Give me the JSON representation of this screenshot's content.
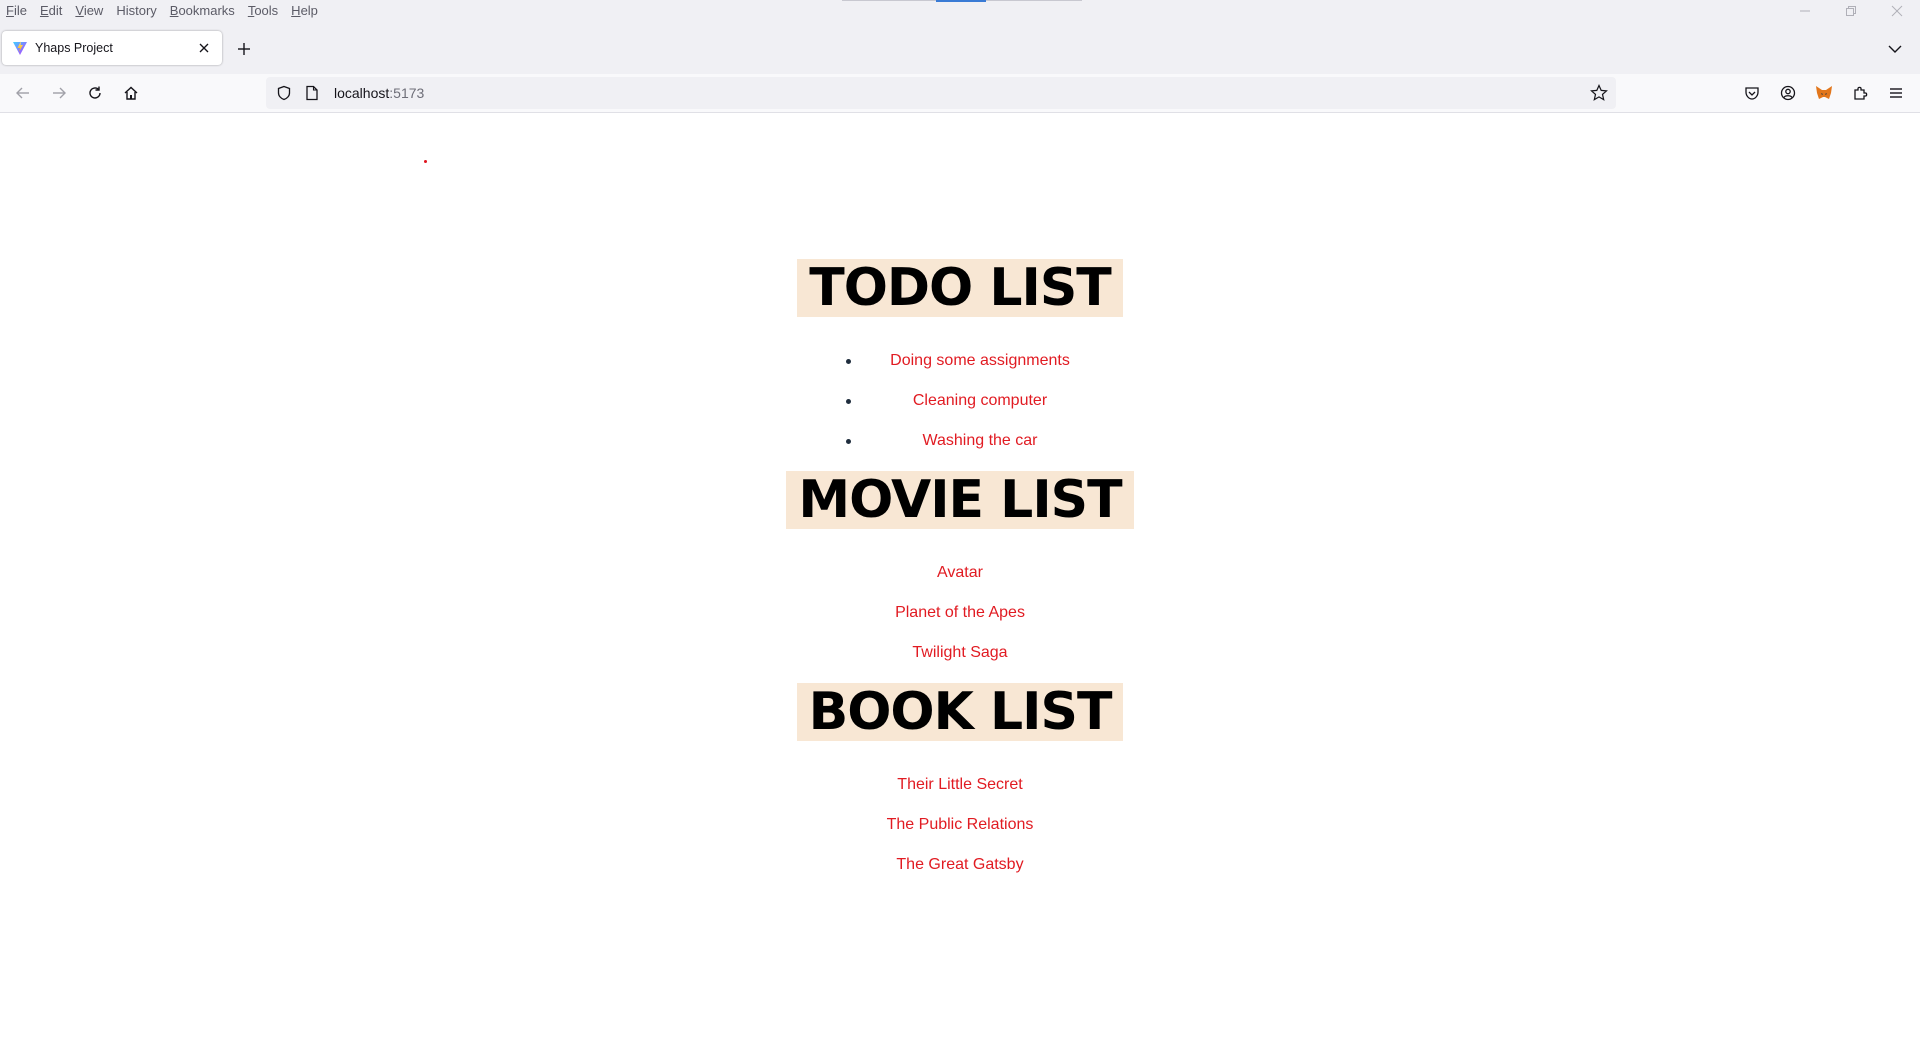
{
  "menubar": {
    "items": [
      {
        "accel": "F",
        "rest": "ile"
      },
      {
        "accel": "E",
        "rest": "dit"
      },
      {
        "accel": "V",
        "rest": "iew"
      },
      {
        "accel": "",
        "rest": "History"
      },
      {
        "accel": "B",
        "rest": "ookmarks"
      },
      {
        "accel": "T",
        "rest": "ools"
      },
      {
        "accel": "H",
        "rest": "elp"
      }
    ]
  },
  "tab": {
    "title": "Yhaps Project",
    "favicon": "vite-logo-icon"
  },
  "address": {
    "host": "localhost",
    "port": ":5173"
  },
  "page": {
    "todo": {
      "heading": "TODO LIST",
      "items": [
        "Doing some assignments",
        "Cleaning computer",
        "Washing the car"
      ]
    },
    "movies": {
      "heading": "MOVIE LIST",
      "items": [
        "Avatar",
        "Planet of the Apes",
        "Twilight Saga"
      ]
    },
    "books": {
      "heading": "BOOK LIST",
      "items": [
        "Their Little Secret",
        "The Public Relations",
        "The Great Gatsby"
      ]
    }
  },
  "colors": {
    "item_text": "#e11b22",
    "heading_bg": "#f8e7d4",
    "bullet": "#1f2d3d"
  }
}
